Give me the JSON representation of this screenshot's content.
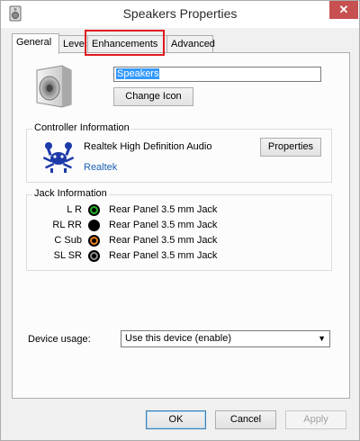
{
  "window": {
    "title": "Speakers Properties",
    "close_glyph": "✕"
  },
  "tabs": [
    {
      "label": "General",
      "active": true
    },
    {
      "label": "Levels",
      "active": false
    },
    {
      "label": "Enhancements",
      "active": false
    },
    {
      "label": "Advanced",
      "active": false
    }
  ],
  "device": {
    "name_value": "Speakers",
    "change_icon_label": "Change Icon"
  },
  "controller": {
    "group_label": "Controller Information",
    "name": "Realtek High Definition Audio",
    "vendor_link": "Realtek",
    "properties_label": "Properties"
  },
  "jack": {
    "group_label": "Jack Information",
    "rows": [
      {
        "label": "L R",
        "text": "Rear Panel 3.5 mm Jack",
        "color": "#1fb31f"
      },
      {
        "label": "RL RR",
        "text": "Rear Panel 3.5 mm Jack",
        "color": "#000000"
      },
      {
        "label": "C Sub",
        "text": "Rear Panel 3.5 mm Jack",
        "color": "#e8801a"
      },
      {
        "label": "SL SR",
        "text": "Rear Panel 3.5 mm Jack",
        "color": "#8a8a8a"
      }
    ]
  },
  "usage": {
    "label": "Device usage:",
    "selected": "Use this device (enable)",
    "arrow": "▼"
  },
  "footer": {
    "ok": "OK",
    "cancel": "Cancel",
    "apply": "Apply"
  },
  "colors": {
    "highlight": "#e0191d",
    "link": "#1a5fb4",
    "close_bg": "#c75050"
  },
  "icons": {
    "app": "speaker-app-icon",
    "device": "speaker-icon",
    "vendor": "realtek-crab-logo"
  }
}
